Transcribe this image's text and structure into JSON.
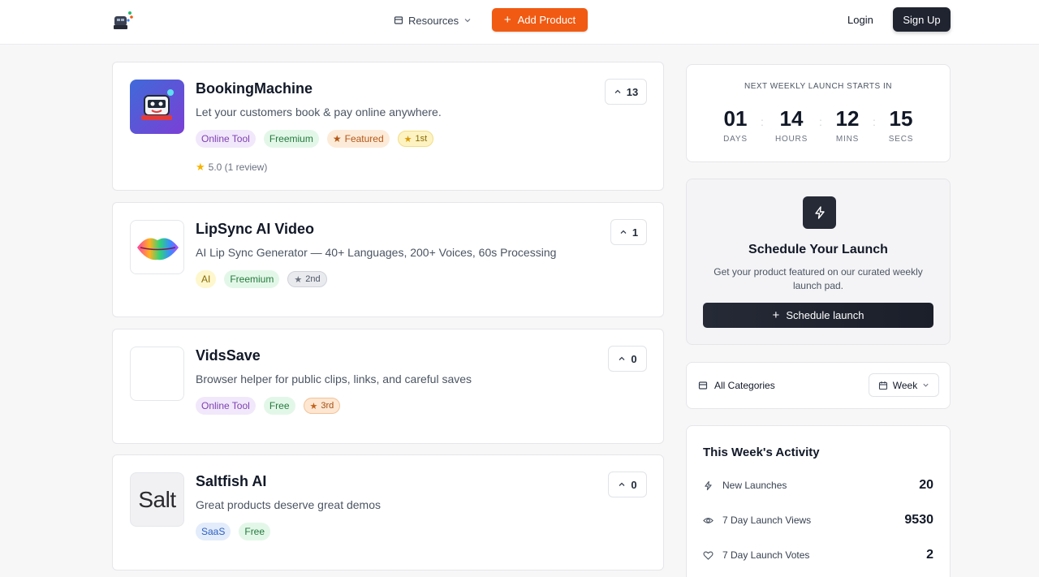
{
  "header": {
    "resources_label": "Resources",
    "add_product_label": "Add Product",
    "login_label": "Login",
    "signup_label": "Sign Up"
  },
  "products": [
    {
      "name": "BookingMachine",
      "description": "Let your customers book & pay online anywhere.",
      "tags": [
        "Online Tool",
        "Freemium",
        "Featured"
      ],
      "rank": "1st",
      "rating": "5.0 (1 review)",
      "votes": "13"
    },
    {
      "name": "LipSync AI Video",
      "description": "AI Lip Sync Generator — 40+ Languages, 200+ Voices, 60s Processing",
      "tags": [
        "AI",
        "Freemium"
      ],
      "rank": "2nd",
      "votes": "1"
    },
    {
      "name": "VidsSave",
      "description": "Browser helper for public clips, links, and careful saves",
      "tags": [
        "Online Tool",
        "Free"
      ],
      "rank": "3rd",
      "votes": "0"
    },
    {
      "name": "Saltfish AI",
      "description": "Great products deserve great demos",
      "tags": [
        "SaaS",
        "Free"
      ],
      "thumb_text": "Salt",
      "votes": "0"
    }
  ],
  "countdown": {
    "label": "NEXT WEEKLY LAUNCH STARTS IN",
    "units": [
      {
        "value": "01",
        "caption": "DAYS"
      },
      {
        "value": "14",
        "caption": "HOURS"
      },
      {
        "value": "12",
        "caption": "MINS"
      },
      {
        "value": "15",
        "caption": "SECS"
      }
    ]
  },
  "schedule": {
    "title": "Schedule Your Launch",
    "description": "Get your product featured on our curated weekly launch pad.",
    "button_label": "Schedule launch"
  },
  "filters": {
    "category_label": "All Categories",
    "period_label": "Week"
  },
  "activity": {
    "title": "This Week's Activity",
    "rows": [
      {
        "label": "New Launches",
        "value": "20",
        "icon": "bolt-icon"
      },
      {
        "label": "7 Day Launch Views",
        "value": "9530",
        "icon": "eye-icon"
      },
      {
        "label": "7 Day Launch Votes",
        "value": "2",
        "icon": "heart-icon"
      }
    ]
  },
  "colors": {
    "accent": "#f15a12",
    "dark": "#1f2430"
  }
}
